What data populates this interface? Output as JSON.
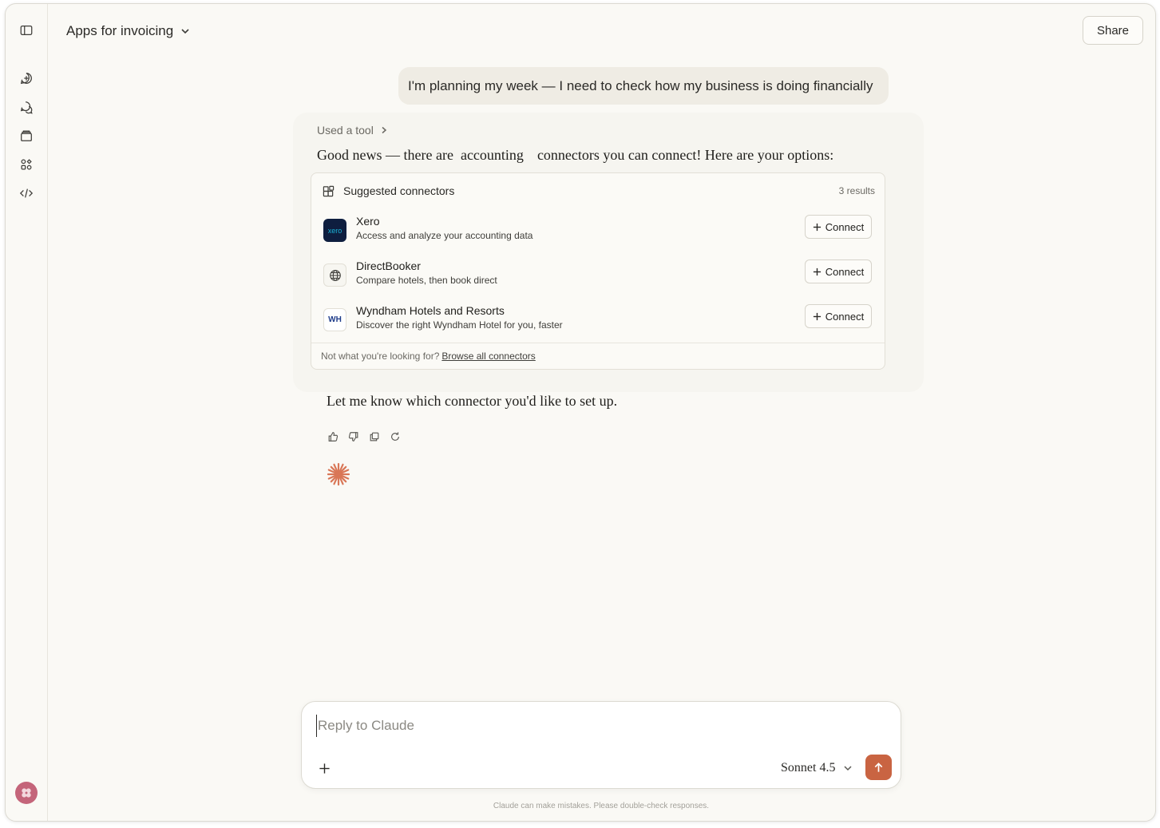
{
  "header": {
    "title": "Apps for invoicing",
    "share_label": "Share"
  },
  "sidebar": {
    "icons": [
      "sidebar-toggle-icon",
      "new-chat-icon",
      "chats-icon",
      "projects-icon",
      "artifacts-icon",
      "code-icon"
    ]
  },
  "conversation": {
    "user_message": "I'm planning my week — I need to check how my business is doing financially",
    "used_tool_label": "Used a tool",
    "answer_parts": [
      "Good news — there are",
      "accounting",
      "connectors you can connect! Here are your options:"
    ],
    "followup": "Let me know which connector you'd like to set up."
  },
  "connectors_card": {
    "title": "Suggested connectors",
    "count": "3 results",
    "items": [
      {
        "name": "Xero",
        "description": "Access and analyze your accounting data",
        "logo_text": "xero",
        "connect_label": "Connect"
      },
      {
        "name": "DirectBooker",
        "description": "Compare hotels, then book direct",
        "logo_text": "",
        "connect_label": "Connect"
      },
      {
        "name": "Wyndham Hotels and Resorts",
        "description": "Discover the right Wyndham Hotel for you, faster",
        "logo_text": "WH",
        "connect_label": "Connect"
      }
    ],
    "footer_text": "Not what you're looking for?",
    "footer_link": "Browse all connectors"
  },
  "composer": {
    "placeholder": "Reply to Claude",
    "model": "Sonnet 4.5",
    "disclaimer": "Claude can make mistakes. Please double-check responses."
  },
  "colors": {
    "accent": "#c96442",
    "background": "#faf9f5",
    "bubble": "#efece4"
  }
}
